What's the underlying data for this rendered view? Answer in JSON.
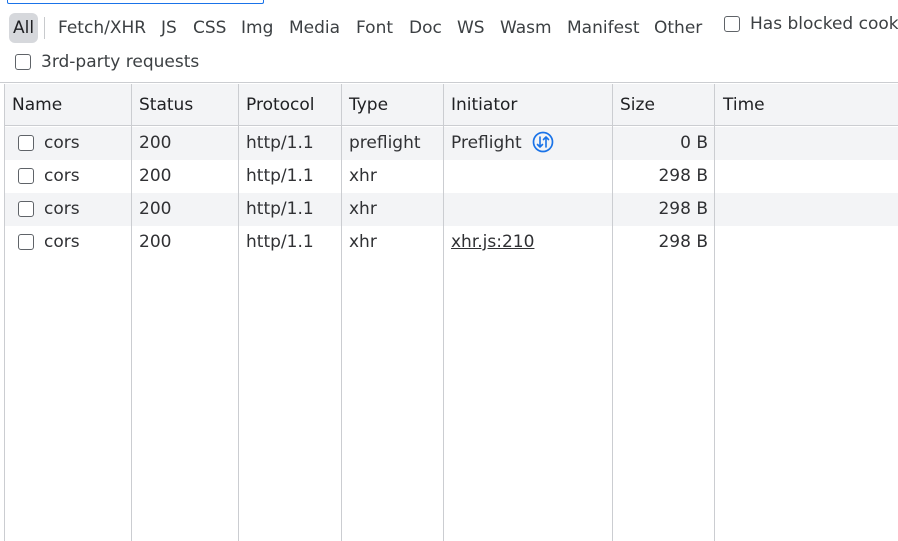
{
  "filters": {
    "types": [
      "All",
      "Fetch/XHR",
      "JS",
      "CSS",
      "Img",
      "Media",
      "Font",
      "Doc",
      "WS",
      "Wasm",
      "Manifest",
      "Other"
    ],
    "has_blocked_label": "Has blocked cook",
    "third_party_label": "3rd-party requests"
  },
  "columns": [
    "Name",
    "Status",
    "Protocol",
    "Type",
    "Initiator",
    "Size",
    "Time"
  ],
  "rows": [
    {
      "name": "cors",
      "status": "200",
      "protocol": "http/1.1",
      "type": "preflight",
      "initiator": "Preflight",
      "size": "0 B",
      "time": ""
    },
    {
      "name": "cors",
      "status": "200",
      "protocol": "http/1.1",
      "type": "xhr",
      "initiator": "",
      "size": "298 B",
      "time": ""
    },
    {
      "name": "cors",
      "status": "200",
      "protocol": "http/1.1",
      "type": "xhr",
      "initiator": "",
      "size": "298 B",
      "time": ""
    },
    {
      "name": "cors",
      "status": "200",
      "protocol": "http/1.1",
      "type": "xhr",
      "initiator": "xhr.js:210",
      "size": "298 B",
      "time": ""
    }
  ],
  "colors": {
    "accent": "#1a73e8",
    "active_filter_bg": "#d6d8dc",
    "stripe": "#f3f4f6",
    "border": "#cbcdd1"
  },
  "icons": {
    "preflight": "preflight-arrows-icon"
  }
}
